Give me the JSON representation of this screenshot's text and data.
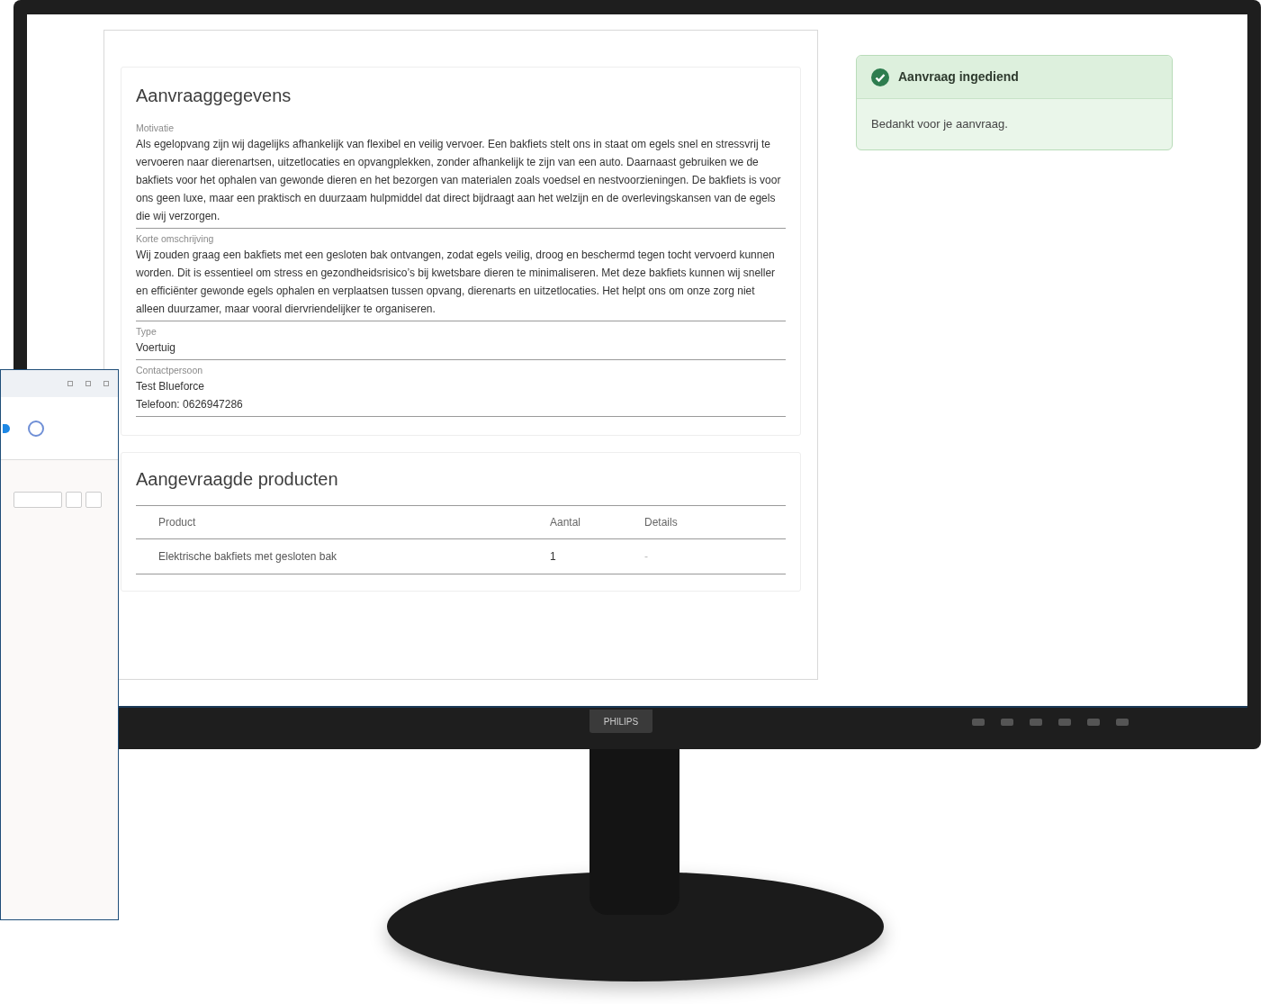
{
  "request_details": {
    "title": "Aanvraaggegevens",
    "fields": [
      {
        "label": "Motivatie",
        "values": [
          "Als egelopvang zijn wij dagelijks afhankelijk van flexibel en veilig vervoer. Een bakfiets stelt ons in staat om egels snel en stressvrij te vervoeren naar dierenartsen, uitzetlocaties en opvangplekken, zonder afhankelijk te zijn van een auto. Daarnaast gebruiken we de bakfiets voor het ophalen van gewonde dieren en het bezorgen van materialen zoals voedsel en nestvoorzieningen. De bakfiets is voor ons geen luxe, maar een praktisch en duurzaam hulpmiddel dat direct bijdraagt aan het welzijn en de overlevingskansen van de egels die wij verzorgen."
        ]
      },
      {
        "label": "Korte omschrijving",
        "values": [
          "Wij zouden graag een bakfiets met een gesloten bak ontvangen, zodat egels veilig, droog en beschermd tegen tocht vervoerd kunnen worden. Dit is essentieel om stress en gezondheidsrisico’s bij kwetsbare dieren te minimaliseren. Met deze bakfiets kunnen wij sneller en efficiënter gewonde egels ophalen en verplaatsen tussen opvang, dierenarts en uitzetlocaties. Het helpt ons om onze zorg niet alleen duurzamer, maar vooral diervriendelijker te organiseren."
        ]
      },
      {
        "label": "Type",
        "values": [
          "Voertuig"
        ]
      },
      {
        "label": "Contactpersoon",
        "values": [
          "Test Blueforce",
          "Telefoon: 0626947286"
        ]
      }
    ]
  },
  "products": {
    "title": "Aangevraagde producten",
    "columns": [
      "Product",
      "Aantal",
      "Details"
    ],
    "rows": [
      [
        "Elektrische bakfiets met gesloten bak",
        "1",
        "-"
      ]
    ]
  },
  "alert": {
    "title": "Aanvraag ingediend",
    "message": "Bedankt voor je aanvraag."
  },
  "monitor": {
    "bezel_label": "PHILIPS"
  }
}
